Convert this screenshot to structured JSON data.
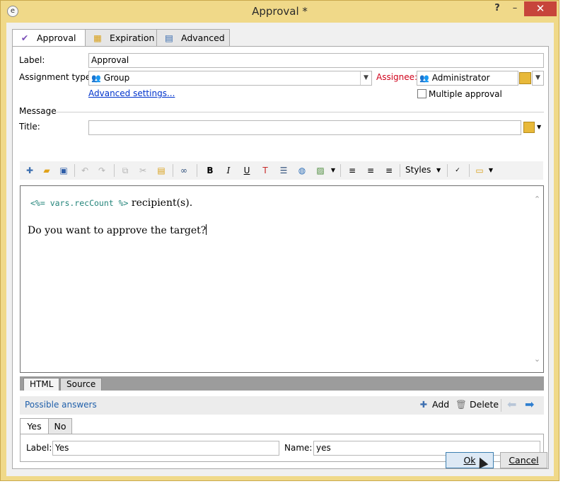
{
  "window": {
    "title": "Approval *",
    "help": "?",
    "minimize": "–",
    "close": "✕",
    "app_icon": "e"
  },
  "tabs": [
    {
      "label": "Approval",
      "icon": "✔"
    },
    {
      "label": "Expiration",
      "icon": "▦"
    },
    {
      "label": "Advanced",
      "icon": "▤"
    }
  ],
  "form": {
    "label_caption": "Label:",
    "label_value": "Approval",
    "assignment_caption": "Assignment type:",
    "assignment_value": "Group",
    "assignee_caption": "Assignee:",
    "assignee_value": "Administrator",
    "advanced_settings": "Advanced settings...",
    "multiple_approval": "Multiple approval",
    "message_caption": "Message",
    "title_caption": "Title:",
    "title_value": ""
  },
  "toolbar": {
    "styles_label": "Styles",
    "bold": "B",
    "italic": "I",
    "underline": "U"
  },
  "editor": {
    "code": "<%= vars.recCount %>",
    "line1_text": " recipient(s).",
    "line2_text": "Do you want to approve the target?",
    "tabs": [
      "HTML",
      "Source"
    ]
  },
  "answers": {
    "title": "Possible answers",
    "add": "Add",
    "delete": "Delete",
    "tabs": [
      "Yes",
      "No"
    ],
    "label_caption": "Label:",
    "label_value": "Yes",
    "name_caption": "Name:",
    "name_value": "yes"
  },
  "buttons": {
    "ok": "Ok",
    "cancel": "Cancel"
  },
  "colors": {
    "frame": "#f0d989",
    "close": "#c7453b",
    "link": "#0033cc",
    "assignee": "#d0021b",
    "code": "#23847a"
  }
}
